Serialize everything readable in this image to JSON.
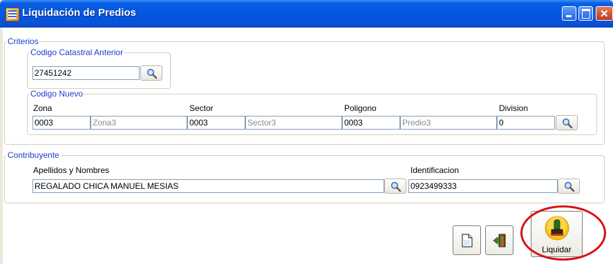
{
  "window": {
    "title": "Liquidación de Predios"
  },
  "criterios": {
    "legend": "Criterios",
    "anterior": {
      "legend": "Codigo Catastral Anterior",
      "value": "27451242"
    },
    "nuevo": {
      "legend": "Codigo Nuevo",
      "zona_label": "Zona",
      "zona_value": "0003",
      "zona_name_placeholder": "Zona3",
      "sector_label": "Sector",
      "sector_value": "0003",
      "sector_name_placeholder": "Sector3",
      "poligono_label": "Poligono",
      "poligono_value": "0003",
      "poligono_name_placeholder": "Predio3",
      "division_label": "Division",
      "division_value": "0"
    }
  },
  "contribuyente": {
    "legend": "Contribuyente",
    "nombres_label": "Apellidos y Nombres",
    "nombres_value": "REGALADO CHICA MANUEL MESIAS",
    "identificacion_label": "Identificacion",
    "identificacion_value": "0923499333"
  },
  "actions": {
    "liquidar_label": "Liquidar"
  },
  "icons": {
    "search": "magnifier-icon",
    "new": "new-document-icon",
    "exit": "exit-door-icon",
    "liquidar": "stamp-icon",
    "app": "app-window-icon"
  },
  "colors": {
    "group_legend": "#1a3ec9",
    "titlebar": "#0456e0",
    "highlight_ring": "#d80f12"
  }
}
